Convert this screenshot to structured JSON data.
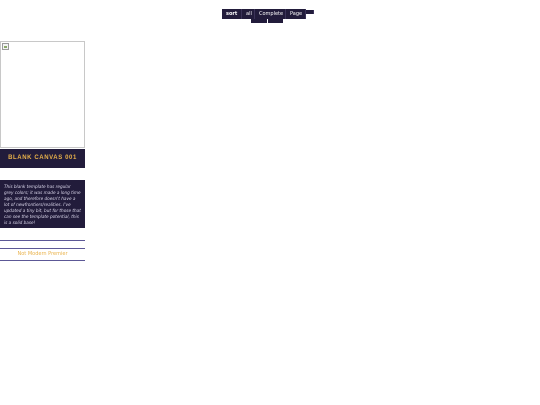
{
  "nav": {
    "items": [
      {
        "label": "sort",
        "active": true
      },
      {
        "label": "all",
        "active": false
      },
      {
        "label": "Complete",
        "active": false
      },
      {
        "label": "Page",
        "active": false
      }
    ]
  },
  "sidebar": {
    "title": "BLANK CANVAS 001",
    "description": "This blank template has regular grey colors; it was made a long time ago, and therefore doesn't have a lot of newfrontiers/realities. I've updated a tiny bit, but for those that can see the template potential, this is a solid base!",
    "credit": "Not Modern Premier"
  },
  "colors": {
    "navy": "#221c3b",
    "gold": "#e9b24a",
    "divider": "#5c5896"
  }
}
